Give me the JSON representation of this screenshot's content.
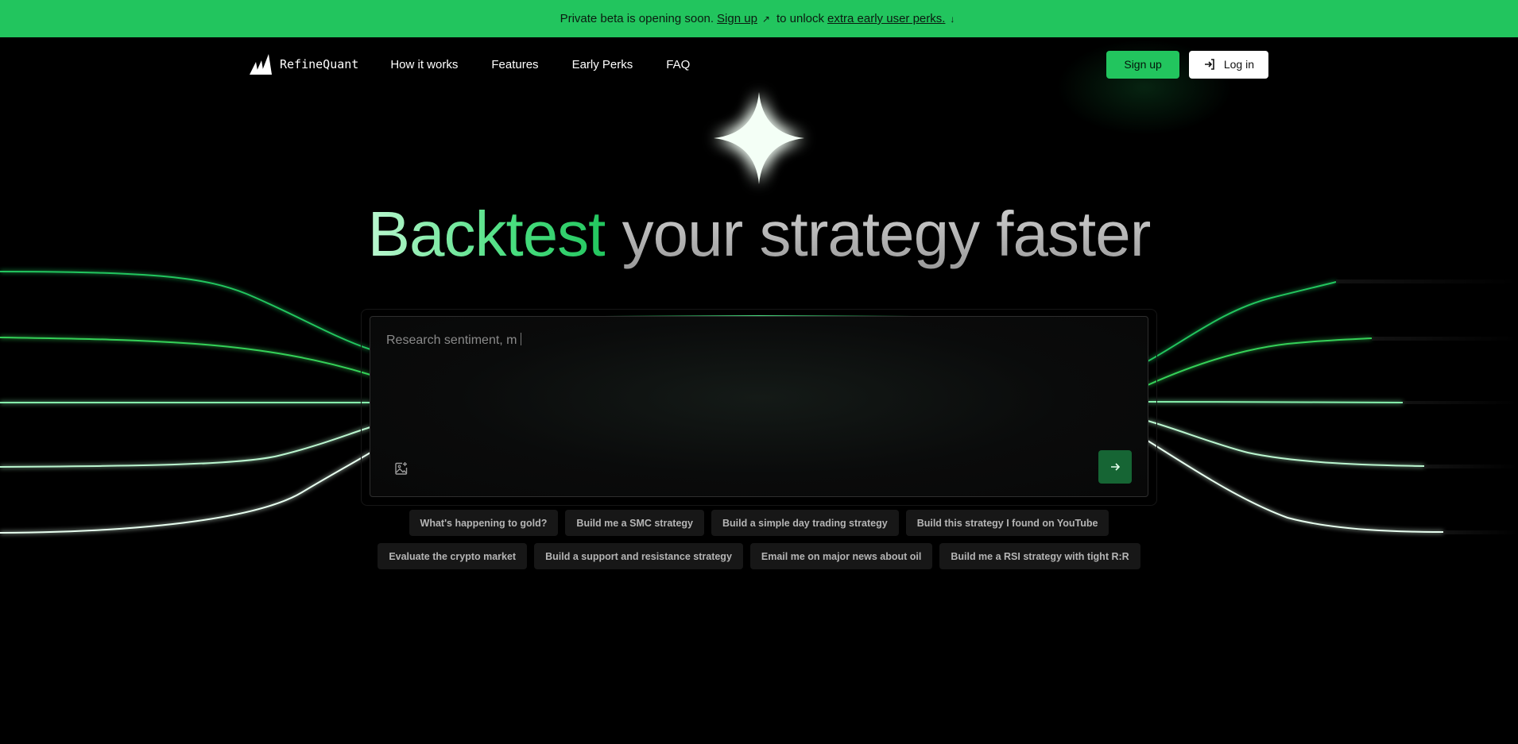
{
  "banner": {
    "prefix": "Private beta is opening soon.",
    "signup_link": "Sign up",
    "middle": "to unlock",
    "perks_link": "extra early user perks."
  },
  "nav": {
    "brand": "RefineQuant",
    "links": [
      "How it works",
      "Features",
      "Early Perks",
      "FAQ"
    ],
    "signup_label": "Sign up",
    "login_label": "Log in"
  },
  "hero": {
    "headline_accent": "Backtest",
    "headline_rest": "your strategy faster"
  },
  "prompt": {
    "typed_text": "Research sentiment, m"
  },
  "suggestions": {
    "row1": [
      "What's happening to gold?",
      "Build me a SMC strategy",
      "Build a simple day trading strategy",
      "Build this strategy I found on YouTube"
    ],
    "row2": [
      "Evaluate the crypto market",
      "Build a support and resistance strategy",
      "Email me on major news about oil",
      "Build me a RSI strategy with tight R:R"
    ]
  },
  "colors": {
    "accent": "#22c55e",
    "banner_bg": "#22c55e",
    "send_button": "#166534",
    "background": "#000000"
  },
  "icons": {
    "banner_signup": "arrow-up-right-icon",
    "banner_perks": "arrow-down-icon",
    "login": "login-icon",
    "attach": "image-plus-icon",
    "send": "arrow-right-icon"
  }
}
